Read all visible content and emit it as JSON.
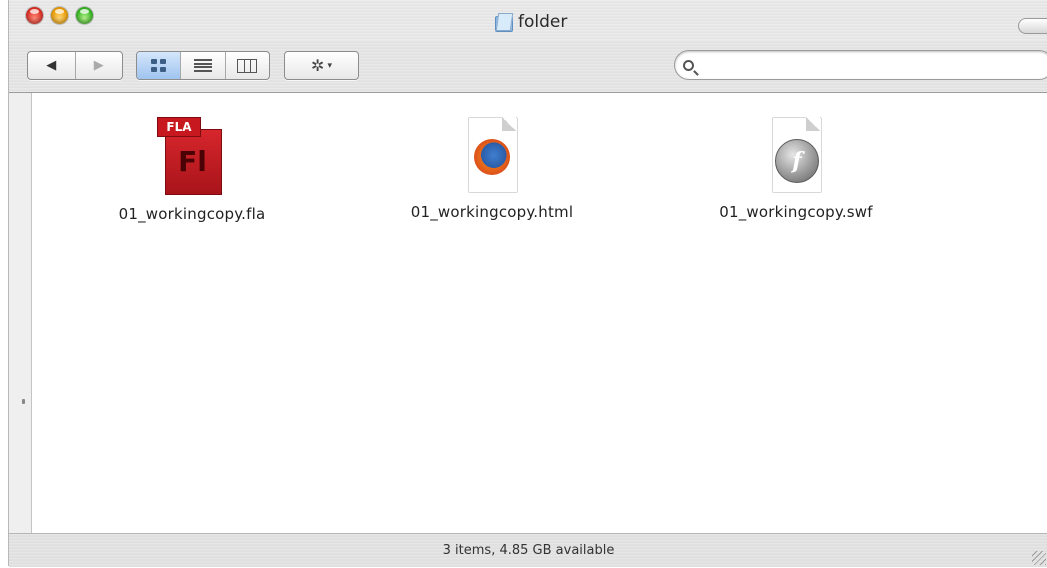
{
  "window": {
    "title": "folder",
    "title_icon": "folder-icon"
  },
  "toolbar": {
    "back_icon": "◀",
    "forward_icon": "▶",
    "view_modes": [
      "icon-view",
      "list-view",
      "column-view"
    ],
    "active_view": "icon-view",
    "action_icon": "✲",
    "action_caret": "▾"
  },
  "search": {
    "value": "",
    "placeholder": ""
  },
  "files": [
    {
      "name": "01_workingcopy.fla",
      "icon": "flash-fla-icon",
      "badge_tab": "FLA",
      "badge_text": "Fl"
    },
    {
      "name": "01_workingcopy.html",
      "icon": "firefox-html-icon"
    },
    {
      "name": "01_workingcopy.swf",
      "icon": "flash-swf-icon",
      "badge_text": "f"
    }
  ],
  "status": {
    "text": "3 items, 4.85 GB available"
  },
  "colors": {
    "close": "#e0342a",
    "minimize": "#f0a30a",
    "zoom": "#3cbb2a",
    "fla_red": "#c8181f",
    "view_active": "#9fc4ef"
  }
}
